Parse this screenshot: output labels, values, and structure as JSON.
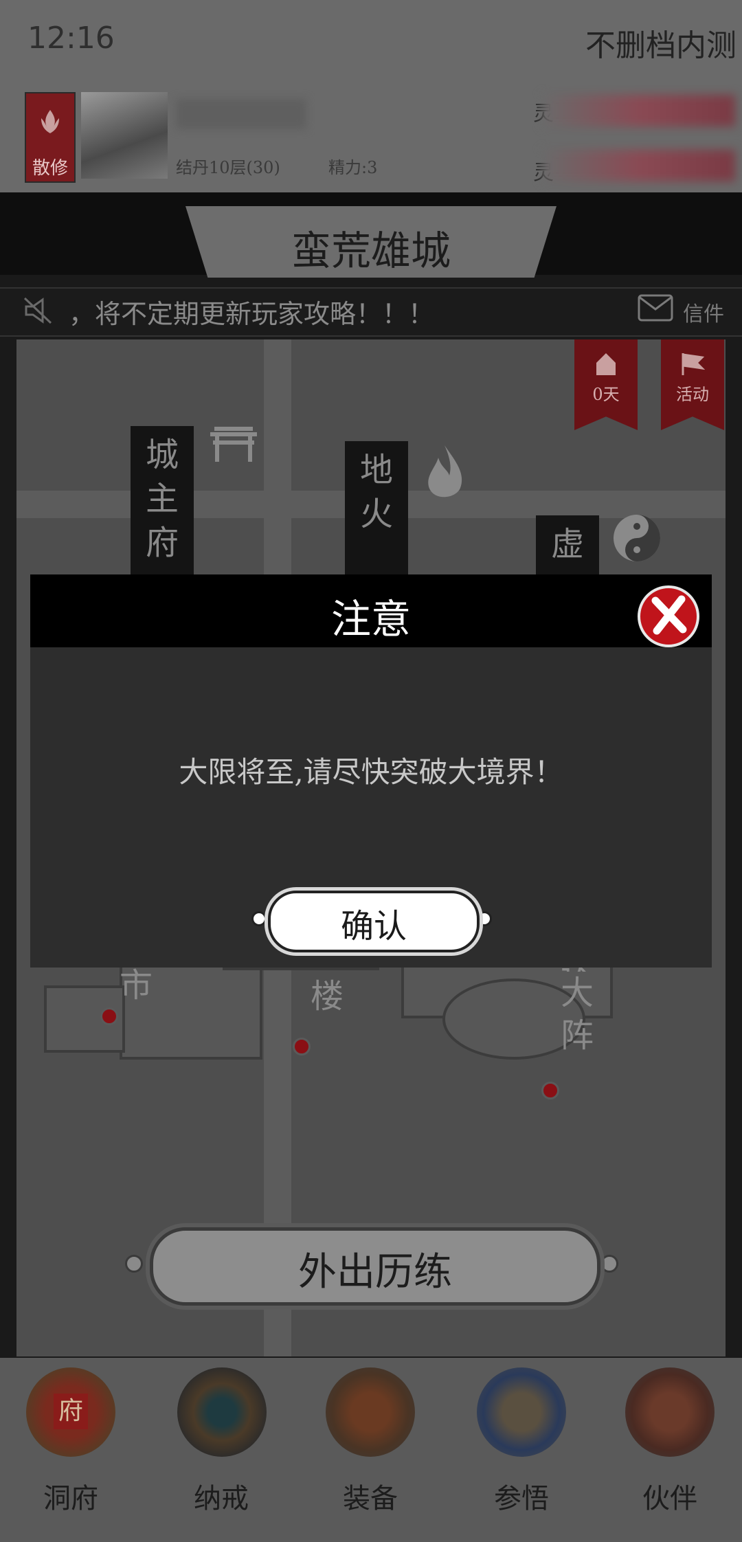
{
  "status_bar": {
    "time": "12:16",
    "server_name": "不删档内测"
  },
  "player": {
    "sect_label": "散修",
    "realm": "结丹10层(30)",
    "energy": "精力:3",
    "stat1_label": "灵",
    "stat2_label": "灵"
  },
  "city": {
    "name": "蛮荒雄城"
  },
  "notice": {
    "text": "，将不定期更新玩家攻略！！！",
    "mail_label": "信件"
  },
  "map": {
    "flags": [
      {
        "label": "0天",
        "icon": "token-icon"
      },
      {
        "label": "活动",
        "icon": "flag-icon"
      }
    ],
    "signs": [
      {
        "chars": [
          "城",
          "主",
          "府"
        ]
      },
      {
        "chars": [
          "地",
          "火"
        ]
      },
      {
        "chars": [
          "虚"
        ]
      }
    ],
    "labels": {
      "market": "市",
      "tower": "楼",
      "formation": [
        "达",
        "大",
        "阵"
      ]
    },
    "adventure_button": "外出历练"
  },
  "dialog": {
    "title": "注意",
    "message": "大限将至,请尽快突破大境界！",
    "confirm_label": "确认"
  },
  "bottom_nav": [
    {
      "label": "洞府",
      "icon": "cave-palace-icon",
      "emblem": "府"
    },
    {
      "label": "纳戒",
      "icon": "storage-ring-icon"
    },
    {
      "label": "装备",
      "icon": "armor-icon"
    },
    {
      "label": "参悟",
      "icon": "scroll-icon"
    },
    {
      "label": "伙伴",
      "icon": "companion-icon"
    }
  ],
  "colors": {
    "accent_red": "#c0141b",
    "dim_red": "#6a1216",
    "dialog_bg": "#2d2d2d",
    "overlay_gray": "#5a5a5a"
  }
}
